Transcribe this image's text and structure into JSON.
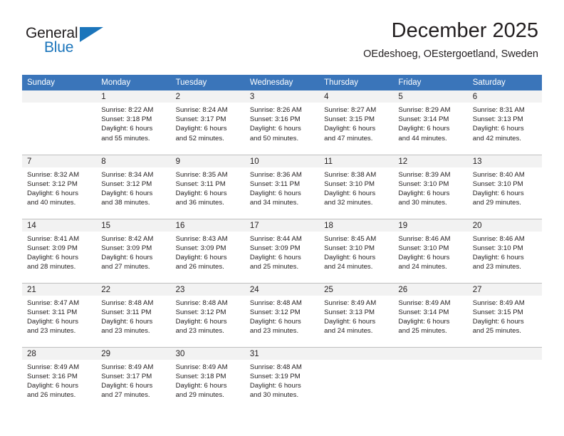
{
  "logo": {
    "word1": "General",
    "word2": "Blue",
    "triangle_color": "#1b75bb",
    "icon": "triangle-icon"
  },
  "header": {
    "title": "December 2025",
    "subtitle": "OEdeshoeg, OEstergoetland, Sweden"
  },
  "colors": {
    "header_blue": "#3a75ba",
    "daynum_band": "#f2f2f2",
    "grid_line": "#bfbfbf",
    "text": "#231f20",
    "brand_blue": "#1b75bb"
  },
  "calendar": {
    "weekday_headers": [
      "Sunday",
      "Monday",
      "Tuesday",
      "Wednesday",
      "Thursday",
      "Friday",
      "Saturday"
    ],
    "weeks": [
      [
        {
          "day": "",
          "blank": true,
          "sunrise": "",
          "sunset": "",
          "daylight_a": "",
          "daylight_b": ""
        },
        {
          "day": "1",
          "blank": false,
          "sunrise": "Sunrise: 8:22 AM",
          "sunset": "Sunset: 3:18 PM",
          "daylight_a": "Daylight: 6 hours",
          "daylight_b": "and 55 minutes."
        },
        {
          "day": "2",
          "blank": false,
          "sunrise": "Sunrise: 8:24 AM",
          "sunset": "Sunset: 3:17 PM",
          "daylight_a": "Daylight: 6 hours",
          "daylight_b": "and 52 minutes."
        },
        {
          "day": "3",
          "blank": false,
          "sunrise": "Sunrise: 8:26 AM",
          "sunset": "Sunset: 3:16 PM",
          "daylight_a": "Daylight: 6 hours",
          "daylight_b": "and 50 minutes."
        },
        {
          "day": "4",
          "blank": false,
          "sunrise": "Sunrise: 8:27 AM",
          "sunset": "Sunset: 3:15 PM",
          "daylight_a": "Daylight: 6 hours",
          "daylight_b": "and 47 minutes."
        },
        {
          "day": "5",
          "blank": false,
          "sunrise": "Sunrise: 8:29 AM",
          "sunset": "Sunset: 3:14 PM",
          "daylight_a": "Daylight: 6 hours",
          "daylight_b": "and 44 minutes."
        },
        {
          "day": "6",
          "blank": false,
          "sunrise": "Sunrise: 8:31 AM",
          "sunset": "Sunset: 3:13 PM",
          "daylight_a": "Daylight: 6 hours",
          "daylight_b": "and 42 minutes."
        }
      ],
      [
        {
          "day": "7",
          "blank": false,
          "sunrise": "Sunrise: 8:32 AM",
          "sunset": "Sunset: 3:12 PM",
          "daylight_a": "Daylight: 6 hours",
          "daylight_b": "and 40 minutes."
        },
        {
          "day": "8",
          "blank": false,
          "sunrise": "Sunrise: 8:34 AM",
          "sunset": "Sunset: 3:12 PM",
          "daylight_a": "Daylight: 6 hours",
          "daylight_b": "and 38 minutes."
        },
        {
          "day": "9",
          "blank": false,
          "sunrise": "Sunrise: 8:35 AM",
          "sunset": "Sunset: 3:11 PM",
          "daylight_a": "Daylight: 6 hours",
          "daylight_b": "and 36 minutes."
        },
        {
          "day": "10",
          "blank": false,
          "sunrise": "Sunrise: 8:36 AM",
          "sunset": "Sunset: 3:11 PM",
          "daylight_a": "Daylight: 6 hours",
          "daylight_b": "and 34 minutes."
        },
        {
          "day": "11",
          "blank": false,
          "sunrise": "Sunrise: 8:38 AM",
          "sunset": "Sunset: 3:10 PM",
          "daylight_a": "Daylight: 6 hours",
          "daylight_b": "and 32 minutes."
        },
        {
          "day": "12",
          "blank": false,
          "sunrise": "Sunrise: 8:39 AM",
          "sunset": "Sunset: 3:10 PM",
          "daylight_a": "Daylight: 6 hours",
          "daylight_b": "and 30 minutes."
        },
        {
          "day": "13",
          "blank": false,
          "sunrise": "Sunrise: 8:40 AM",
          "sunset": "Sunset: 3:10 PM",
          "daylight_a": "Daylight: 6 hours",
          "daylight_b": "and 29 minutes."
        }
      ],
      [
        {
          "day": "14",
          "blank": false,
          "sunrise": "Sunrise: 8:41 AM",
          "sunset": "Sunset: 3:09 PM",
          "daylight_a": "Daylight: 6 hours",
          "daylight_b": "and 28 minutes."
        },
        {
          "day": "15",
          "blank": false,
          "sunrise": "Sunrise: 8:42 AM",
          "sunset": "Sunset: 3:09 PM",
          "daylight_a": "Daylight: 6 hours",
          "daylight_b": "and 27 minutes."
        },
        {
          "day": "16",
          "blank": false,
          "sunrise": "Sunrise: 8:43 AM",
          "sunset": "Sunset: 3:09 PM",
          "daylight_a": "Daylight: 6 hours",
          "daylight_b": "and 26 minutes."
        },
        {
          "day": "17",
          "blank": false,
          "sunrise": "Sunrise: 8:44 AM",
          "sunset": "Sunset: 3:09 PM",
          "daylight_a": "Daylight: 6 hours",
          "daylight_b": "and 25 minutes."
        },
        {
          "day": "18",
          "blank": false,
          "sunrise": "Sunrise: 8:45 AM",
          "sunset": "Sunset: 3:10 PM",
          "daylight_a": "Daylight: 6 hours",
          "daylight_b": "and 24 minutes."
        },
        {
          "day": "19",
          "blank": false,
          "sunrise": "Sunrise: 8:46 AM",
          "sunset": "Sunset: 3:10 PM",
          "daylight_a": "Daylight: 6 hours",
          "daylight_b": "and 24 minutes."
        },
        {
          "day": "20",
          "blank": false,
          "sunrise": "Sunrise: 8:46 AM",
          "sunset": "Sunset: 3:10 PM",
          "daylight_a": "Daylight: 6 hours",
          "daylight_b": "and 23 minutes."
        }
      ],
      [
        {
          "day": "21",
          "blank": false,
          "sunrise": "Sunrise: 8:47 AM",
          "sunset": "Sunset: 3:11 PM",
          "daylight_a": "Daylight: 6 hours",
          "daylight_b": "and 23 minutes."
        },
        {
          "day": "22",
          "blank": false,
          "sunrise": "Sunrise: 8:48 AM",
          "sunset": "Sunset: 3:11 PM",
          "daylight_a": "Daylight: 6 hours",
          "daylight_b": "and 23 minutes."
        },
        {
          "day": "23",
          "blank": false,
          "sunrise": "Sunrise: 8:48 AM",
          "sunset": "Sunset: 3:12 PM",
          "daylight_a": "Daylight: 6 hours",
          "daylight_b": "and 23 minutes."
        },
        {
          "day": "24",
          "blank": false,
          "sunrise": "Sunrise: 8:48 AM",
          "sunset": "Sunset: 3:12 PM",
          "daylight_a": "Daylight: 6 hours",
          "daylight_b": "and 23 minutes."
        },
        {
          "day": "25",
          "blank": false,
          "sunrise": "Sunrise: 8:49 AM",
          "sunset": "Sunset: 3:13 PM",
          "daylight_a": "Daylight: 6 hours",
          "daylight_b": "and 24 minutes."
        },
        {
          "day": "26",
          "blank": false,
          "sunrise": "Sunrise: 8:49 AM",
          "sunset": "Sunset: 3:14 PM",
          "daylight_a": "Daylight: 6 hours",
          "daylight_b": "and 25 minutes."
        },
        {
          "day": "27",
          "blank": false,
          "sunrise": "Sunrise: 8:49 AM",
          "sunset": "Sunset: 3:15 PM",
          "daylight_a": "Daylight: 6 hours",
          "daylight_b": "and 25 minutes."
        }
      ],
      [
        {
          "day": "28",
          "blank": false,
          "sunrise": "Sunrise: 8:49 AM",
          "sunset": "Sunset: 3:16 PM",
          "daylight_a": "Daylight: 6 hours",
          "daylight_b": "and 26 minutes."
        },
        {
          "day": "29",
          "blank": false,
          "sunrise": "Sunrise: 8:49 AM",
          "sunset": "Sunset: 3:17 PM",
          "daylight_a": "Daylight: 6 hours",
          "daylight_b": "and 27 minutes."
        },
        {
          "day": "30",
          "blank": false,
          "sunrise": "Sunrise: 8:49 AM",
          "sunset": "Sunset: 3:18 PM",
          "daylight_a": "Daylight: 6 hours",
          "daylight_b": "and 29 minutes."
        },
        {
          "day": "31",
          "blank": false,
          "sunrise": "Sunrise: 8:48 AM",
          "sunset": "Sunset: 3:19 PM",
          "daylight_a": "Daylight: 6 hours",
          "daylight_b": "and 30 minutes."
        },
        {
          "day": "",
          "blank": true,
          "sunrise": "",
          "sunset": "",
          "daylight_a": "",
          "daylight_b": ""
        },
        {
          "day": "",
          "blank": true,
          "sunrise": "",
          "sunset": "",
          "daylight_a": "",
          "daylight_b": ""
        },
        {
          "day": "",
          "blank": true,
          "sunrise": "",
          "sunset": "",
          "daylight_a": "",
          "daylight_b": ""
        }
      ]
    ]
  }
}
